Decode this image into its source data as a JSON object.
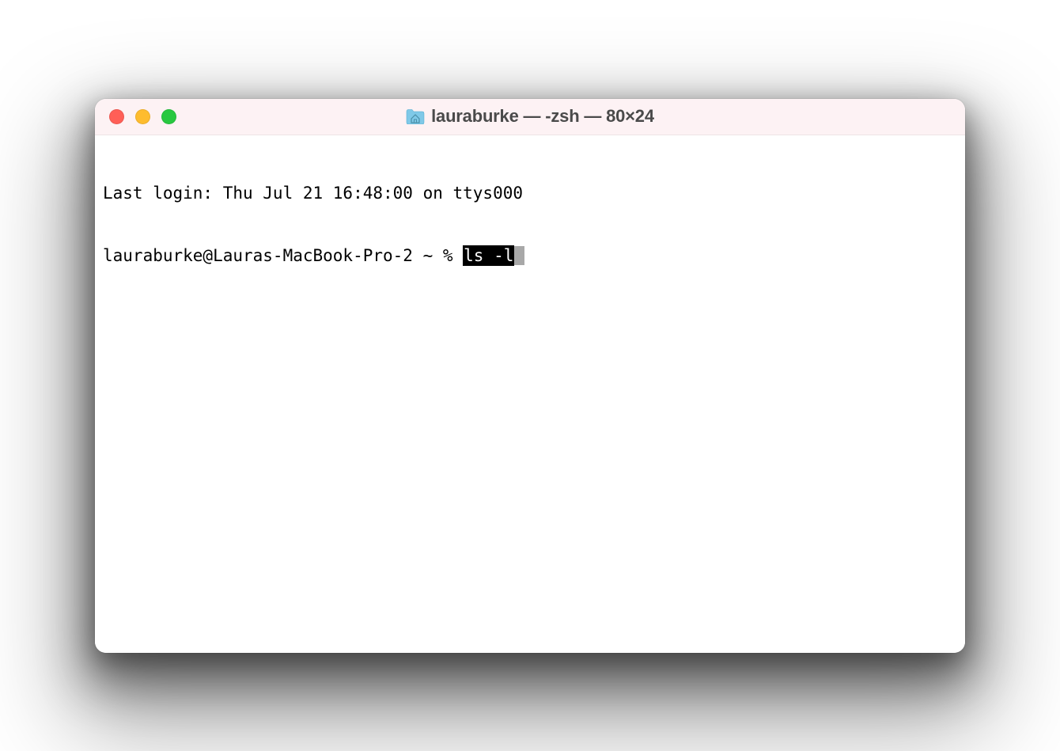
{
  "window": {
    "title": "lauraburke — -zsh — 80×24",
    "icon": "home-folder-icon",
    "traffic": {
      "close": "close",
      "minimize": "minimize",
      "zoom": "zoom"
    }
  },
  "terminal": {
    "login_line": "Last login: Thu Jul 21 16:48:00 on ttys000",
    "prompt": "lauraburke@Lauras-MacBook-Pro-2 ~ % ",
    "command": "ls -l",
    "cursor": "block"
  }
}
